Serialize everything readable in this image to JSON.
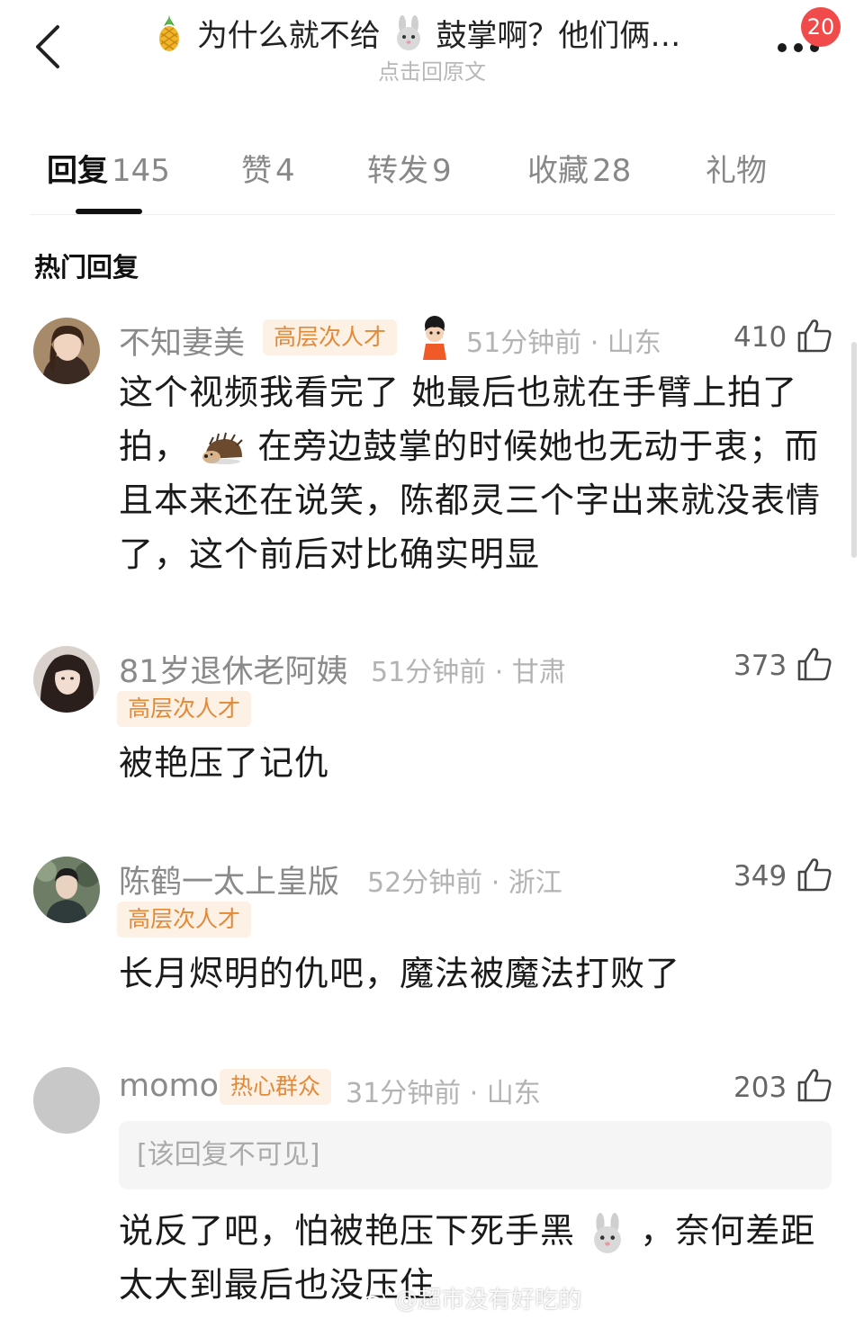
{
  "header": {
    "back_icon": "chevron-left-icon",
    "title_prefix_emoji": "pineapple",
    "title_part1": "为什么就不给",
    "title_mid_emoji": "rabbit",
    "title_part2": "鼓掌啊？他们俩…",
    "subtitle": "点击回原文",
    "more_icon": "more-dots-icon",
    "badge_count": "20"
  },
  "tabs": [
    {
      "label": "回复",
      "count": "145",
      "active": true
    },
    {
      "label": "赞",
      "count": "4",
      "active": false
    },
    {
      "label": "转发",
      "count": "9",
      "active": false
    },
    {
      "label": "收藏",
      "count": "28",
      "active": false
    },
    {
      "label": "礼物",
      "count": "",
      "active": false
    }
  ],
  "section_title": "热门回复",
  "comments": [
    {
      "name": "不知妻美",
      "tag": "高层次人才",
      "badge_emoji": "cartoon-girl",
      "time": "51分钟前",
      "location": "山东",
      "likes": "410",
      "text_part1": "这个视频我看完了 她最后也就在手臂上拍了拍，",
      "inline_emoji": "hedgehog",
      "text_part2": "在旁边鼓掌的时候她也无动于衷；而且本来还在说笑，陈都灵三个字出来就没表情了，这个前后对比确实明显"
    },
    {
      "name": "81岁退休老阿姨",
      "tag": "高层次人才",
      "time": "51分钟前",
      "location": "甘肃",
      "likes": "373",
      "text": "被艳压了记仇"
    },
    {
      "name": "陈鹤一太上皇版",
      "tag": "高层次人才",
      "time": "52分钟前",
      "location": "浙江",
      "likes": "349",
      "text": "长月烬明的仇吧，魔法被魔法打败了"
    },
    {
      "name": "momo",
      "tag": "热心群众",
      "time": "31分钟前",
      "location": "山东",
      "likes": "203",
      "hidden_notice": "[该回复不可见]",
      "text_part1": "说反了吧，怕被艳压下死手黑",
      "inline_emoji": "rabbit",
      "text_part2": "，奈何差距太大到最后也没压住"
    }
  ],
  "watermark": "@超市没有好吃的",
  "colors": {
    "tag_bg": "#fdf0e4",
    "tag_text": "#e08a3a",
    "badge": "#f04a4a",
    "meta_text": "#b3b3b3"
  }
}
